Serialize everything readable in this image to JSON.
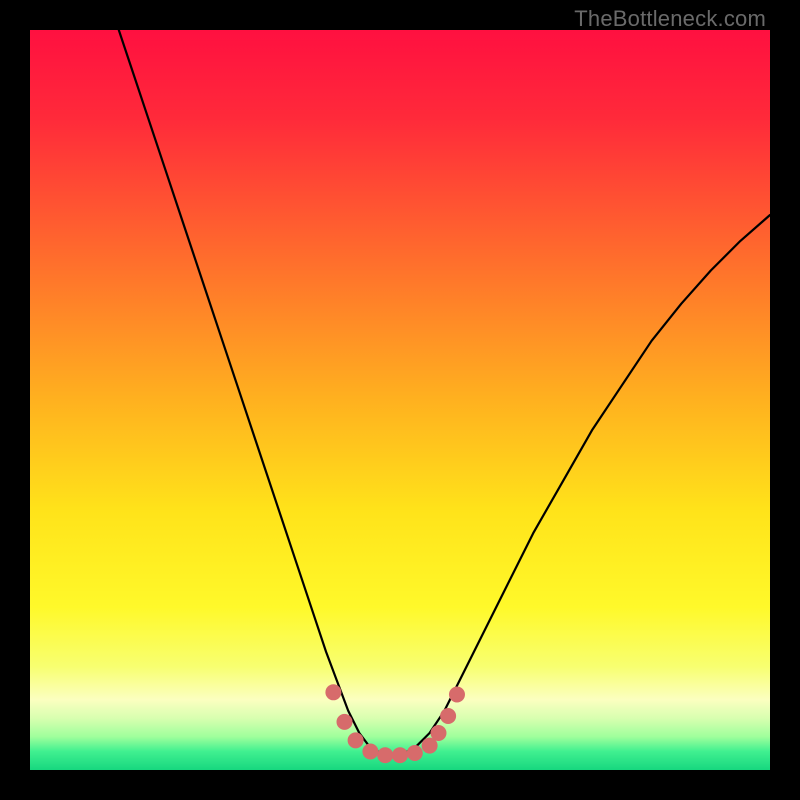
{
  "watermark": "TheBottleneck.com",
  "chart_data": {
    "type": "line",
    "title": "",
    "xlabel": "",
    "ylabel": "",
    "xlim": [
      0,
      100
    ],
    "ylim": [
      0,
      100
    ],
    "grid": false,
    "legend": false,
    "gradient_stops": [
      {
        "pos": 0.0,
        "color": "#ff1040"
      },
      {
        "pos": 0.12,
        "color": "#ff2a3a"
      },
      {
        "pos": 0.3,
        "color": "#ff6a2d"
      },
      {
        "pos": 0.5,
        "color": "#ffb11f"
      },
      {
        "pos": 0.65,
        "color": "#ffe31a"
      },
      {
        "pos": 0.78,
        "color": "#fff92a"
      },
      {
        "pos": 0.86,
        "color": "#f8ff70"
      },
      {
        "pos": 0.905,
        "color": "#fbffc0"
      },
      {
        "pos": 0.93,
        "color": "#d8ffb0"
      },
      {
        "pos": 0.955,
        "color": "#9fff9c"
      },
      {
        "pos": 0.975,
        "color": "#40f090"
      },
      {
        "pos": 1.0,
        "color": "#17d77f"
      }
    ],
    "series": [
      {
        "name": "bottleneck-curve",
        "color": "#000000",
        "width": 2.2,
        "x": [
          12,
          14,
          16,
          18,
          20,
          22,
          24,
          26,
          28,
          30,
          32,
          34,
          36,
          38,
          40,
          41.5,
          43,
          44.5,
          46,
          48,
          50,
          52,
          54,
          56,
          58,
          60,
          64,
          68,
          72,
          76,
          80,
          84,
          88,
          92,
          96,
          100
        ],
        "y": [
          100,
          94,
          88,
          82,
          76,
          70,
          64,
          58,
          52,
          46,
          40,
          34,
          28,
          22,
          16,
          12,
          8,
          5,
          3,
          2,
          2,
          3,
          5,
          8,
          12,
          16,
          24,
          32,
          39,
          46,
          52,
          58,
          63,
          67.5,
          71.5,
          75
        ]
      }
    ],
    "markers": {
      "name": "trough-markers",
      "color": "#d76b6b",
      "radius": 8,
      "points": [
        {
          "x": 41.0,
          "y": 10.5
        },
        {
          "x": 42.5,
          "y": 6.5
        },
        {
          "x": 44.0,
          "y": 4.0
        },
        {
          "x": 46.0,
          "y": 2.5
        },
        {
          "x": 48.0,
          "y": 2.0
        },
        {
          "x": 50.0,
          "y": 2.0
        },
        {
          "x": 52.0,
          "y": 2.3
        },
        {
          "x": 54.0,
          "y": 3.3
        },
        {
          "x": 55.2,
          "y": 5.0
        },
        {
          "x": 56.5,
          "y": 7.3
        },
        {
          "x": 57.7,
          "y": 10.2
        }
      ]
    }
  }
}
